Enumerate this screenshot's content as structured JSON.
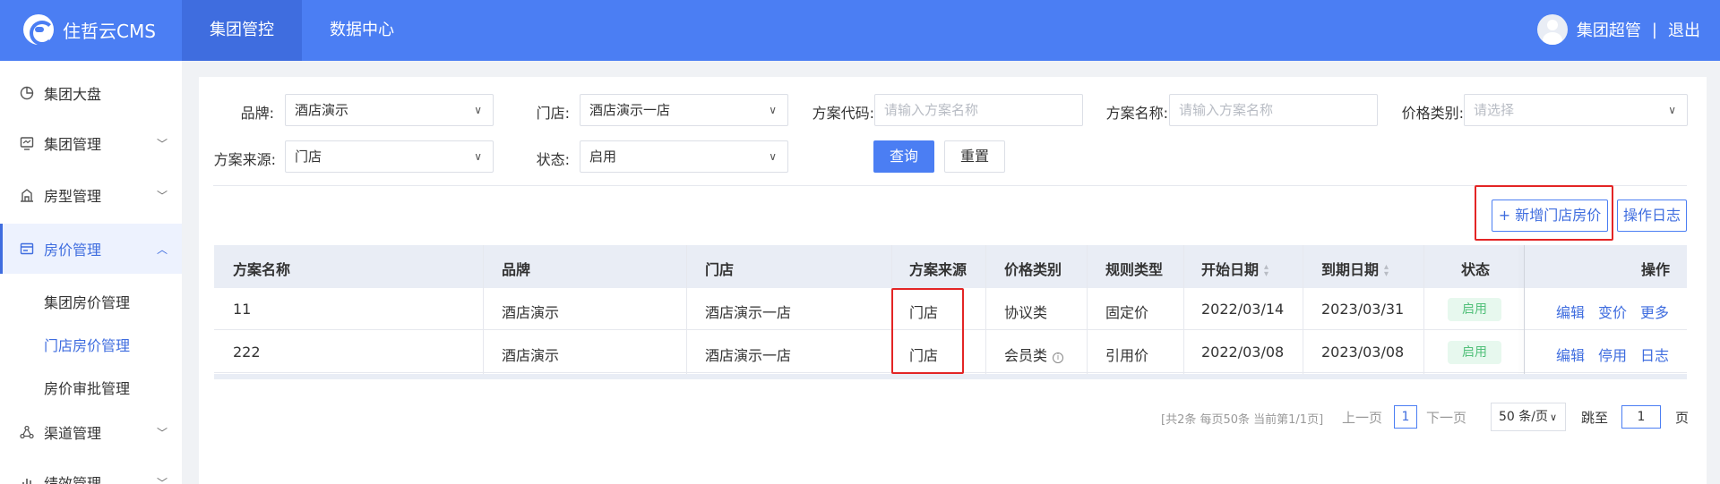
{
  "app": {
    "name": "住哲云CMS"
  },
  "topnav": {
    "tabs": [
      {
        "label": "集团管控"
      },
      {
        "label": "数据中心"
      }
    ]
  },
  "user": {
    "name": "集团超管",
    "separator": "|",
    "logout": "退出"
  },
  "sidebar": {
    "items": [
      {
        "label": "集团大盘",
        "icon": "pie-chart-icon"
      },
      {
        "label": "集团管理",
        "icon": "monitor-icon",
        "chevron": "﹀"
      },
      {
        "label": "房型管理",
        "icon": "building-icon",
        "chevron": "﹀"
      },
      {
        "label": "房价管理",
        "icon": "price-card-icon",
        "chevron": "︿"
      },
      {
        "label": "渠道管理",
        "icon": "network-icon",
        "chevron": "﹀"
      },
      {
        "label": "绩效管理",
        "icon": "chart-icon",
        "chevron": "﹀"
      }
    ],
    "sub_items": [
      {
        "label": "集团房价管理"
      },
      {
        "label": "门店房价管理"
      },
      {
        "label": "房价审批管理"
      }
    ]
  },
  "filters": {
    "brand": {
      "label": "品牌:",
      "value": "酒店演示"
    },
    "store": {
      "label": "门店:",
      "value": "酒店演示一店"
    },
    "plan_code": {
      "label": "方案代码:",
      "placeholder": "请输入方案名称"
    },
    "plan_name": {
      "label": "方案名称:",
      "placeholder": "请输入方案名称"
    },
    "price_type": {
      "label": "价格类别:",
      "placeholder": "请选择"
    },
    "source": {
      "label": "方案来源:",
      "value": "门店"
    },
    "status": {
      "label": "状态:",
      "value": "启用"
    },
    "query_label": "查询",
    "reset_label": "重置"
  },
  "actions": {
    "add_label": "+ 新增门店房价",
    "log_label": "操作日志"
  },
  "table": {
    "headers": [
      "方案名称",
      "品牌",
      "门店",
      "方案来源",
      "价格类别",
      "规则类型",
      "开始日期",
      "到期日期",
      "状态",
      "操作"
    ],
    "rows": [
      {
        "name": "11",
        "brand": "酒店演示",
        "store": "酒店演示一店",
        "source": "门店",
        "price_type": "协议类",
        "rule": "固定价",
        "start": "2022/03/14",
        "end": "2023/03/31",
        "status": "启用",
        "ops": [
          "编辑",
          "变价",
          "更多"
        ]
      },
      {
        "name": "222",
        "brand": "酒店演示",
        "store": "酒店演示一店",
        "source": "门店",
        "price_type": "会员类",
        "rule": "引用价",
        "start": "2022/03/08",
        "end": "2023/03/08",
        "status": "启用",
        "ops": [
          "编辑",
          "停用",
          "日志"
        ]
      }
    ]
  },
  "pagination": {
    "summary": "[共2条 每页50条 当前第1/1页]",
    "prev": "上一页",
    "page": "1",
    "next": "下一页",
    "page_size": "50 条/页",
    "jump_label": "跳至",
    "jump_value": "1",
    "page_suffix": "页"
  },
  "colors": {
    "primary": "#4b7ef3",
    "highlight": "#e32525",
    "success": "#52c07a"
  }
}
